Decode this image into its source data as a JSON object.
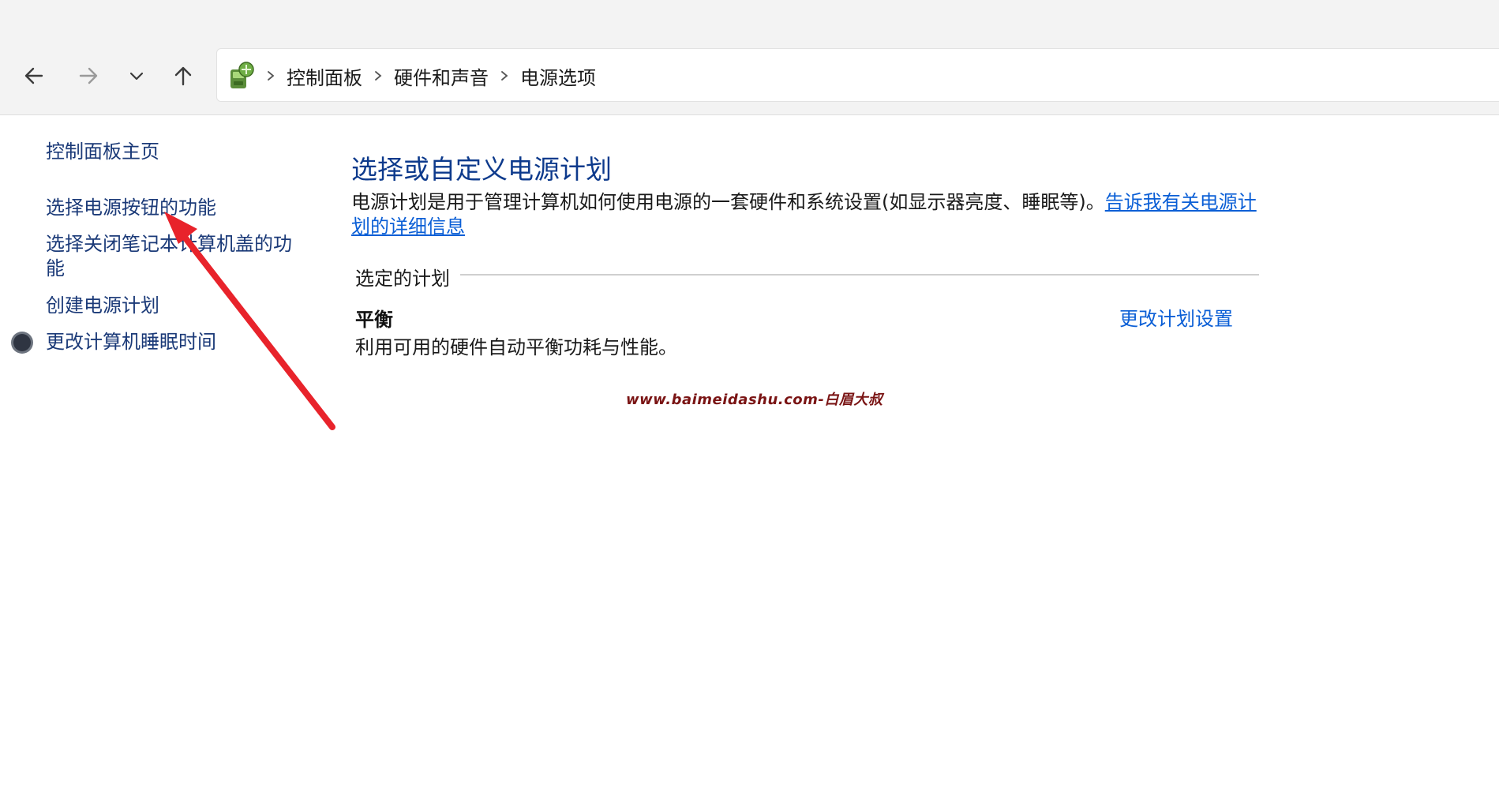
{
  "navbar": {
    "back_icon": "arrow-left-icon",
    "forward_icon": "arrow-right-icon",
    "recent_icon": "chevron-down-icon",
    "up_icon": "arrow-up-icon"
  },
  "address": {
    "icon": "control-panel-icon",
    "breadcrumbs": [
      "控制面板",
      "硬件和声音",
      "电源选项"
    ]
  },
  "sidebar": {
    "items": [
      {
        "label": "控制面板主页"
      },
      {
        "label": "选择电源按钮的功能"
      },
      {
        "label": "选择关闭笔记本计算机盖的功能"
      },
      {
        "label": "创建电源计划"
      },
      {
        "label": "更改计算机睡眠时间",
        "icon": "moon-icon"
      }
    ]
  },
  "main": {
    "title": "选择或自定义电源计划",
    "description": "电源计划是用于管理计算机如何使用电源的一套硬件和系统设置(如显示器亮度、睡眠等)。",
    "description_link": "告诉我有关电源计划的详细信息",
    "section_label": "选定的计划",
    "plan": {
      "name": "平衡",
      "description": "利用可用的硬件自动平衡功耗与性能。",
      "change_link": "更改计划设置"
    }
  },
  "watermark": "www.baimeidashu.com-白眉大叔",
  "colors": {
    "link": "#0b5fd6",
    "sidebar_link": "#1b3a78",
    "title": "#0d3a8c",
    "annotation_arrow": "#e8232b",
    "watermark": "#7a1414"
  }
}
